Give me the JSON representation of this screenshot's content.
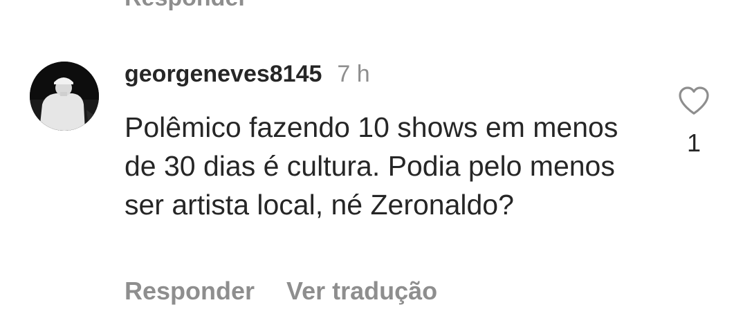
{
  "previous_comment": {
    "reply_label": "Responder"
  },
  "comment": {
    "username": "georgeneves8145",
    "timestamp": "7 h",
    "text": "Polêmico fazendo 10 shows em menos de 30 dias é cultura. Podia pelo menos ser artista local, né Zeronaldo?",
    "reply_label": "Responder",
    "translate_label": "Ver tradução",
    "like_count": "1",
    "like_icon": "heart-outline-icon",
    "avatar": "profile-photo"
  },
  "colors": {
    "text_primary": "#262626",
    "text_secondary": "#8e8e8e",
    "background": "#ffffff"
  }
}
